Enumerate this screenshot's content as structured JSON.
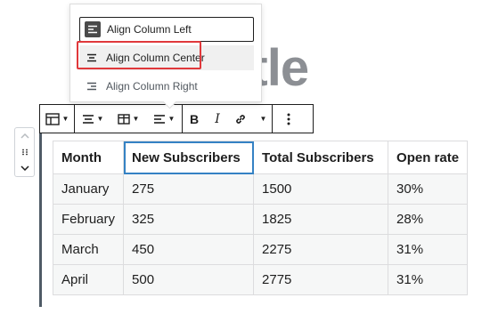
{
  "background_title": "title",
  "dropdown": {
    "items": [
      {
        "label": "Align Column Left",
        "icon": "align-left-icon"
      },
      {
        "label": "Align Column Center",
        "icon": "align-center-icon"
      },
      {
        "label": "Align Column Right",
        "icon": "align-right-icon"
      }
    ],
    "highlight_color": "#e0383b"
  },
  "toolbar": {
    "buttons": [
      "table-icon",
      "align-center-icon",
      "table-edit-icon",
      "align-left-icon",
      "bold-icon",
      "italic-icon",
      "link-icon",
      "more-rich-text-icon",
      "options-icon"
    ],
    "bold_label": "B",
    "italic_label": "I"
  },
  "table": {
    "headers": [
      "Month",
      "New Subscribers",
      "Total Subscribers",
      "Open rate"
    ],
    "rows": [
      [
        "January",
        "275",
        "1500",
        "30%"
      ],
      [
        "February",
        "325",
        "1825",
        "28%"
      ],
      [
        "March",
        "450",
        "2275",
        "31%"
      ],
      [
        "April",
        "500",
        "2775",
        "31%"
      ]
    ],
    "selected_color": "#3582c4"
  }
}
